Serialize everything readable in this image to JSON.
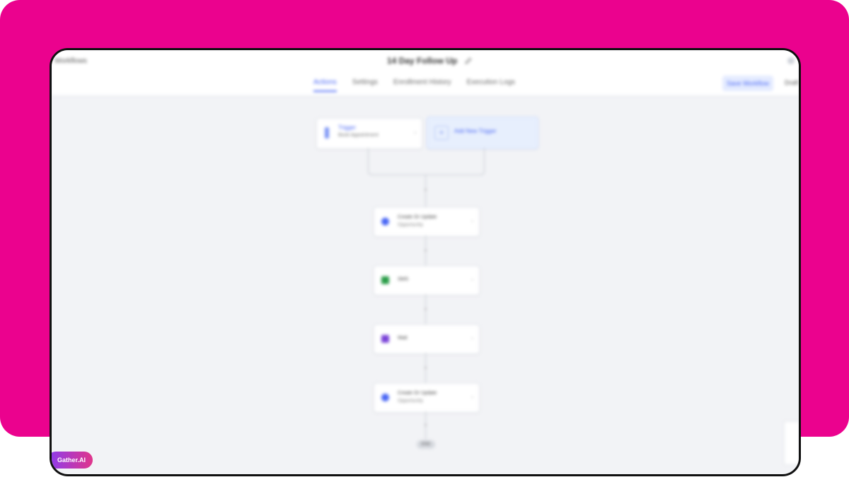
{
  "header": {
    "back_label": "Workflows",
    "title": "14 Day Follow Up",
    "tabs": [
      {
        "label": "Actions",
        "active": true
      },
      {
        "label": "Settings",
        "active": false
      },
      {
        "label": "Enrollment History",
        "active": false
      },
      {
        "label": "Execution Logs",
        "active": false
      }
    ],
    "save_label": "Save Workflow",
    "status_label": "Draft"
  },
  "trigger": {
    "title": "Trigger",
    "subtitle": "Book Appointment",
    "icon": "trigger-icon"
  },
  "add_trigger": {
    "label": "Add New Trigger",
    "icon": "plus-icon"
  },
  "actions": [
    {
      "title": "Create Or Update",
      "subtitle": "Opportunity",
      "icon": "opportunity-icon",
      "color": "#4a67f5"
    },
    {
      "title": "SMS",
      "subtitle": "",
      "icon": "sms-icon",
      "color": "#2a9d48"
    },
    {
      "title": "Wait",
      "subtitle": "",
      "icon": "wait-icon",
      "color": "#7a43d8"
    },
    {
      "title": "Create Or Update",
      "subtitle": "Opportunity",
      "icon": "opportunity-icon",
      "color": "#4a67f5"
    }
  ],
  "end_label": "END",
  "help_label": "Gather.AI",
  "colors": {
    "brand_bg": "#eb028e",
    "accent": "#4a67f5",
    "canvas": "#f2f3f6"
  }
}
